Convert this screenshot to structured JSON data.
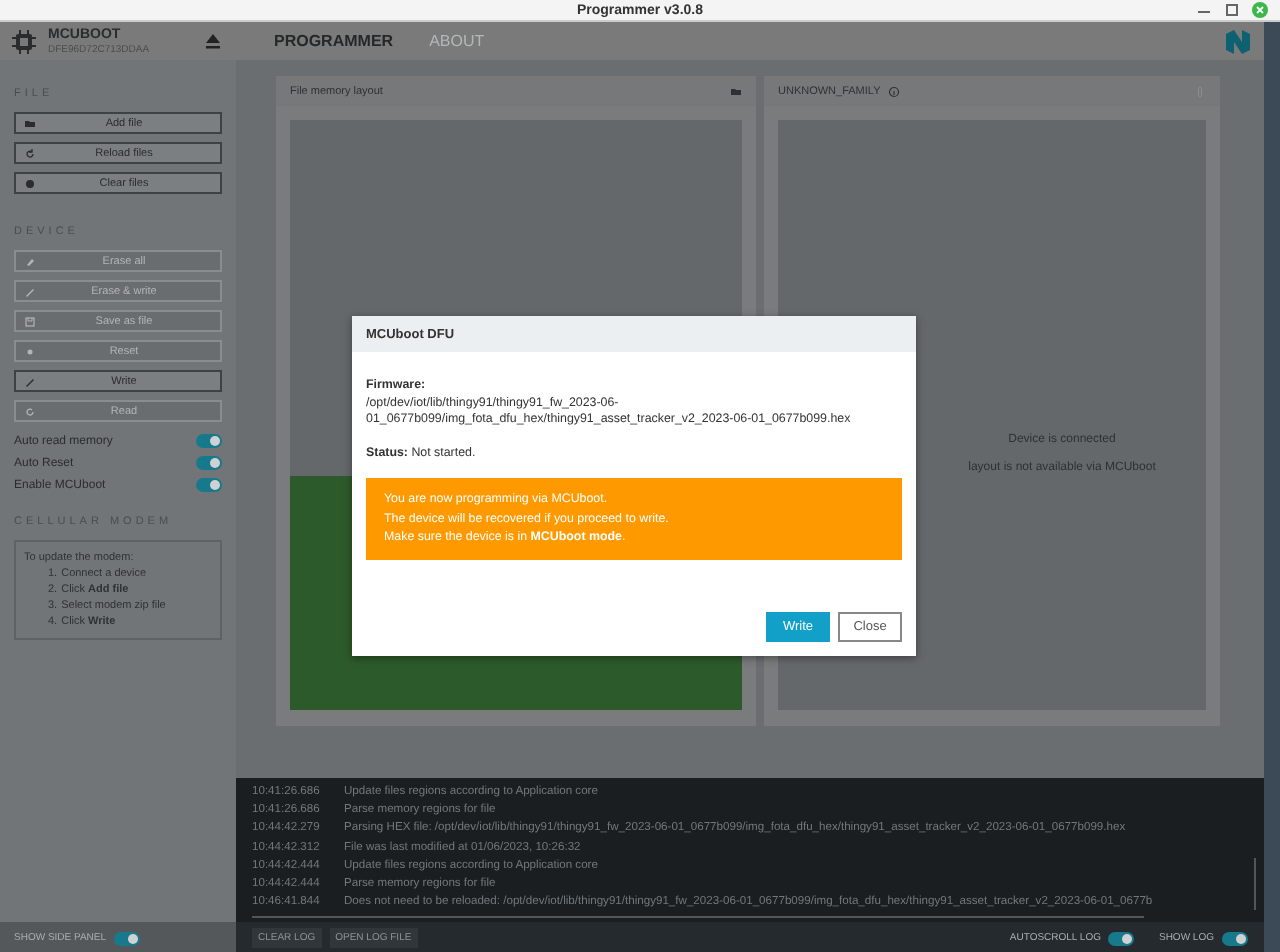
{
  "window": {
    "title": "Programmer v3.0.8"
  },
  "device": {
    "name": "MCUBOOT",
    "serial": "DFE96D72C713DDAA"
  },
  "tabs": [
    {
      "label": "PROGRAMMER",
      "selected": true
    },
    {
      "label": "ABOUT",
      "selected": false
    }
  ],
  "sidebar": {
    "file_title": "FILE",
    "file_buttons": [
      {
        "label": "Add file",
        "disabled": false
      },
      {
        "label": "Reload files",
        "disabled": false
      },
      {
        "label": "Clear files",
        "disabled": false
      }
    ],
    "device_title": "DEVICE",
    "device_buttons": [
      {
        "label": "Erase all",
        "disabled": true
      },
      {
        "label": "Erase & write",
        "disabled": true
      },
      {
        "label": "Save as file",
        "disabled": true
      },
      {
        "label": "Reset",
        "disabled": true
      },
      {
        "label": "Write",
        "disabled": false
      },
      {
        "label": "Read",
        "disabled": true
      }
    ],
    "toggles": [
      {
        "label": "Auto read memory",
        "on": true
      },
      {
        "label": "Auto Reset",
        "on": true
      },
      {
        "label": "Enable MCUboot",
        "on": true
      }
    ],
    "modem_title": "CELLULAR MODEM",
    "modem_intro": "To update the modem:",
    "modem_steps": [
      {
        "number": "1.",
        "text": "Connect a device"
      },
      {
        "number": "2.",
        "text": "Click **Add file**"
      },
      {
        "number": "3.",
        "text": "Select modem zip file"
      },
      {
        "number": "4.",
        "text": "Click **Write**"
      }
    ]
  },
  "file_panel": {
    "title": "File memory layout"
  },
  "device_panel": {
    "title": "UNKNOWN_FAMILY",
    "messages": [
      "Device is connected",
      "layout is not available via MCUboot"
    ]
  },
  "log": [
    {
      "time": "10:41:26.686",
      "message": "Update files regions according to Application core"
    },
    {
      "time": "10:41:26.686",
      "message": "Parse memory regions for file"
    },
    {
      "time": "10:44:42.279",
      "message": "Parsing HEX file: /opt/dev/iot/lib/thingy91/thingy91_fw_2023-06-01_0677b099/img_fota_dfu_hex/thingy91_asset_tracker_v2_2023-06-01_0677b099.hex"
    },
    {
      "time": "10:44:42.312",
      "message": "File was last modified at 01/06/2023, 10:26:32"
    },
    {
      "time": "10:44:42.444",
      "message": "Update files regions according to Application core"
    },
    {
      "time": "10:44:42.444",
      "message": "Parse memory regions for file"
    },
    {
      "time": "10:46:41.844",
      "message": "Does not need to be reloaded: /opt/dev/iot/lib/thingy91/thingy91_fw_2023-06-01_0677b099/img_fota_dfu_hex/thingy91_asset_tracker_v2_2023-06-01_0677b"
    }
  ],
  "side_panel_toggle": {
    "label": "SHOW SIDE PANEL",
    "on": true
  },
  "log_buttons": [
    "CLEAR LOG",
    "OPEN LOG FILE"
  ],
  "log_toggles": [
    {
      "label": "AUTOSCROLL LOG",
      "on": true
    },
    {
      "label": "SHOW LOG",
      "on": true
    }
  ],
  "dialog": {
    "title": "MCUboot DFU",
    "firmware_label": "Firmware:",
    "firmware_path": "/opt/dev/iot/lib/thingy91/thingy91_fw_2023-06-01_0677b099/img_fota_dfu_hex/thingy91_asset_tracker_v2_2023-06-01_0677b099.hex",
    "status": "**Status:** Not started.",
    "warning": [
      "You are now programming via MCUboot.",
      "The device will be recovered if you proceed to write.",
      "Make sure the device is in **MCUboot mode**."
    ],
    "buttons": [
      {
        "label": "Write",
        "kind": "primary"
      },
      {
        "label": "Close",
        "kind": "secondary"
      }
    ]
  }
}
